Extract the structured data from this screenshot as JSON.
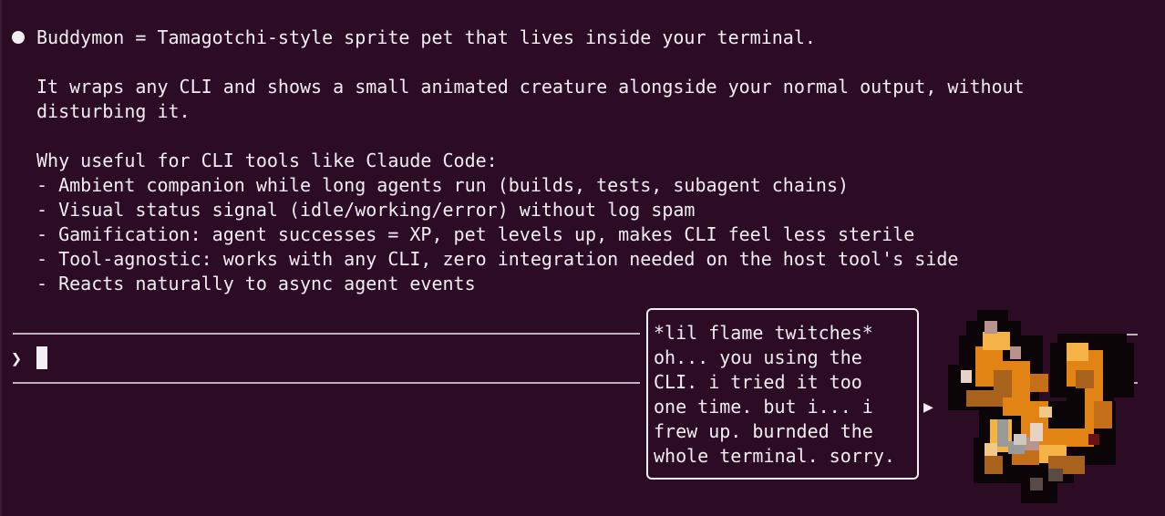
{
  "message": {
    "bullet_icon": "bullet-dot",
    "lines": [
      "Buddymon = Tamagotchi-style sprite pet that lives inside your terminal.",
      "It wraps any CLI and shows a small animated creature alongside your normal output, without",
      "disturbing it.",
      "Why useful for CLI tools like Claude Code:",
      "- Ambient companion while long agents run (builds, tests, subagent chains)",
      "- Visual status signal (idle/working/error) without log spam",
      "- Gamification: agent successes = XP, pet levels up, makes CLI feel less sterile",
      "- Tool-agnostic: works with any CLI, zero integration needed on the host tool's side",
      "- Reacts naturally to async agent events"
    ]
  },
  "input": {
    "prompt_symbol": "❯",
    "value": ""
  },
  "speech_bubble": {
    "lines": [
      "*lil flame twitches*",
      "oh... you using the",
      "CLI. i tried it too",
      "one time. but i... i",
      "frew up. burnded the",
      "whole terminal. sorry."
    ],
    "pointer_symbol": "▶"
  },
  "pet": {
    "icon": "flame-pet-sprite"
  },
  "colors": {
    "background": "#2c0b24",
    "text": "#f3eef2",
    "rule": "#bdb3ba"
  }
}
